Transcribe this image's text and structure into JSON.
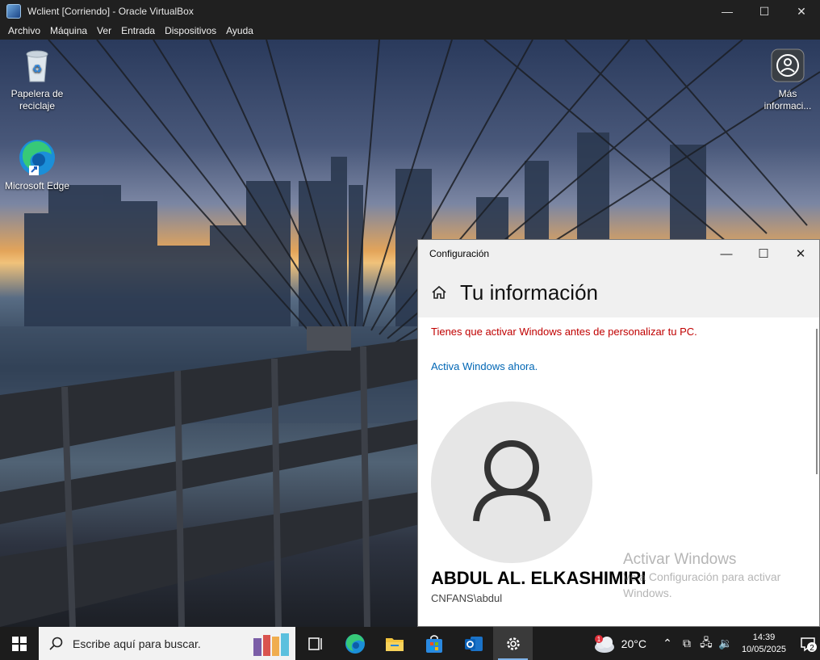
{
  "host_window": {
    "title": "Wclient [Corriendo] - Oracle VirtualBox",
    "minimize": "—",
    "maximize": "☐",
    "close": "✕"
  },
  "host_menu": [
    "Archivo",
    "Máquina",
    "Ver",
    "Entrada",
    "Dispositivos",
    "Ayuda"
  ],
  "desktop": {
    "icons": [
      {
        "label": "Papelera de reciclaje",
        "icon": "recycle-bin-icon"
      },
      {
        "label": "Microsoft Edge",
        "icon": "edge-icon"
      },
      {
        "label": "Más informaci...",
        "icon": "info-camera-icon"
      }
    ]
  },
  "settings": {
    "window_title": "Configuración",
    "page_title": "Tu información",
    "warning": "Tienes que activar Windows antes de personalizar tu PC.",
    "activate_link": "Activa Windows ahora.",
    "user_name": "ABDUL AL. ELKASHIMIRI",
    "user_account": "CNFANS\\abdul"
  },
  "watermark": {
    "title": "Activar Windows",
    "subtitle": "Ve a Configuración para activar Windows."
  },
  "taskbar": {
    "search_placeholder": "Escribe aquí para buscar.",
    "apps": [
      "task-view-icon",
      "edge-icon",
      "file-explorer-icon",
      "store-icon",
      "outlook-icon",
      "settings-icon"
    ],
    "weather_temp": "20°C",
    "weather_badge": "1",
    "time": "14:39",
    "date": "10/05/2025",
    "notification_count": "2"
  },
  "colors": {
    "warning": "#c00000",
    "link": "#0066b4",
    "taskbar": "#1c1c1c",
    "titlebar": "#202020"
  }
}
